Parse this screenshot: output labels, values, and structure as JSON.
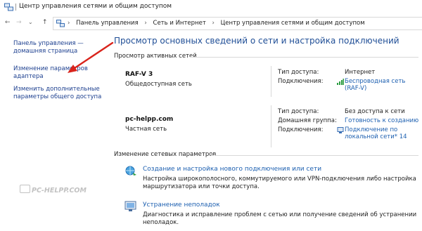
{
  "window": {
    "title": "Центр управления сетями и общим доступом"
  },
  "breadcrumbs": [
    "Панель управления",
    "Сеть и Интернет",
    "Центр управления сетями и общим доступом"
  ],
  "nav": {
    "back": "←",
    "forward": "→",
    "history": "⌄",
    "up": "↑"
  },
  "sidebar": {
    "home": "Панель управления — домашняя страница",
    "adapter": "Изменение параметров адаптера",
    "sharing": "Изменить дополнительные параметры общего доступа"
  },
  "main": {
    "title": "Просмотр основных сведений о сети и настройка подключений",
    "active_header": "Просмотр активных сетей",
    "networks": [
      {
        "name": "RAF-V  3",
        "type": "Общедоступная сеть",
        "access_label": "Тип доступа:",
        "access_value": "Интернет",
        "conn_label": "Подключения:",
        "conn_value": "Беспроводная сеть (RAF-V)"
      },
      {
        "name": "pc-helpp.com",
        "type": "Частная сеть",
        "access_label": "Тип доступа:",
        "access_value": "Без доступа к сети",
        "group_label": "Домашняя группа:",
        "group_value": "Готовность к созданию",
        "conn_label": "Подключения:",
        "conn_value": "Подключение по локальной сети* 14"
      }
    ],
    "change_header": "Изменение сетевых параметров",
    "tasks": [
      {
        "link": "Создание и настройка нового подключения или сети",
        "desc": "Настройка широкополосного, коммутируемого или VPN-подключения либо настройка маршрутизатора или точки доступа."
      },
      {
        "link": "Устранение неполадок",
        "desc": "Диагностика и исправление проблем с сетью или получение сведений об устранении неполадок."
      }
    ]
  },
  "watermark": "PC-HELPP.COM",
  "colors": {
    "link": "#1c5fb0",
    "title": "#1f4e96",
    "arrow": "#d9241c"
  }
}
